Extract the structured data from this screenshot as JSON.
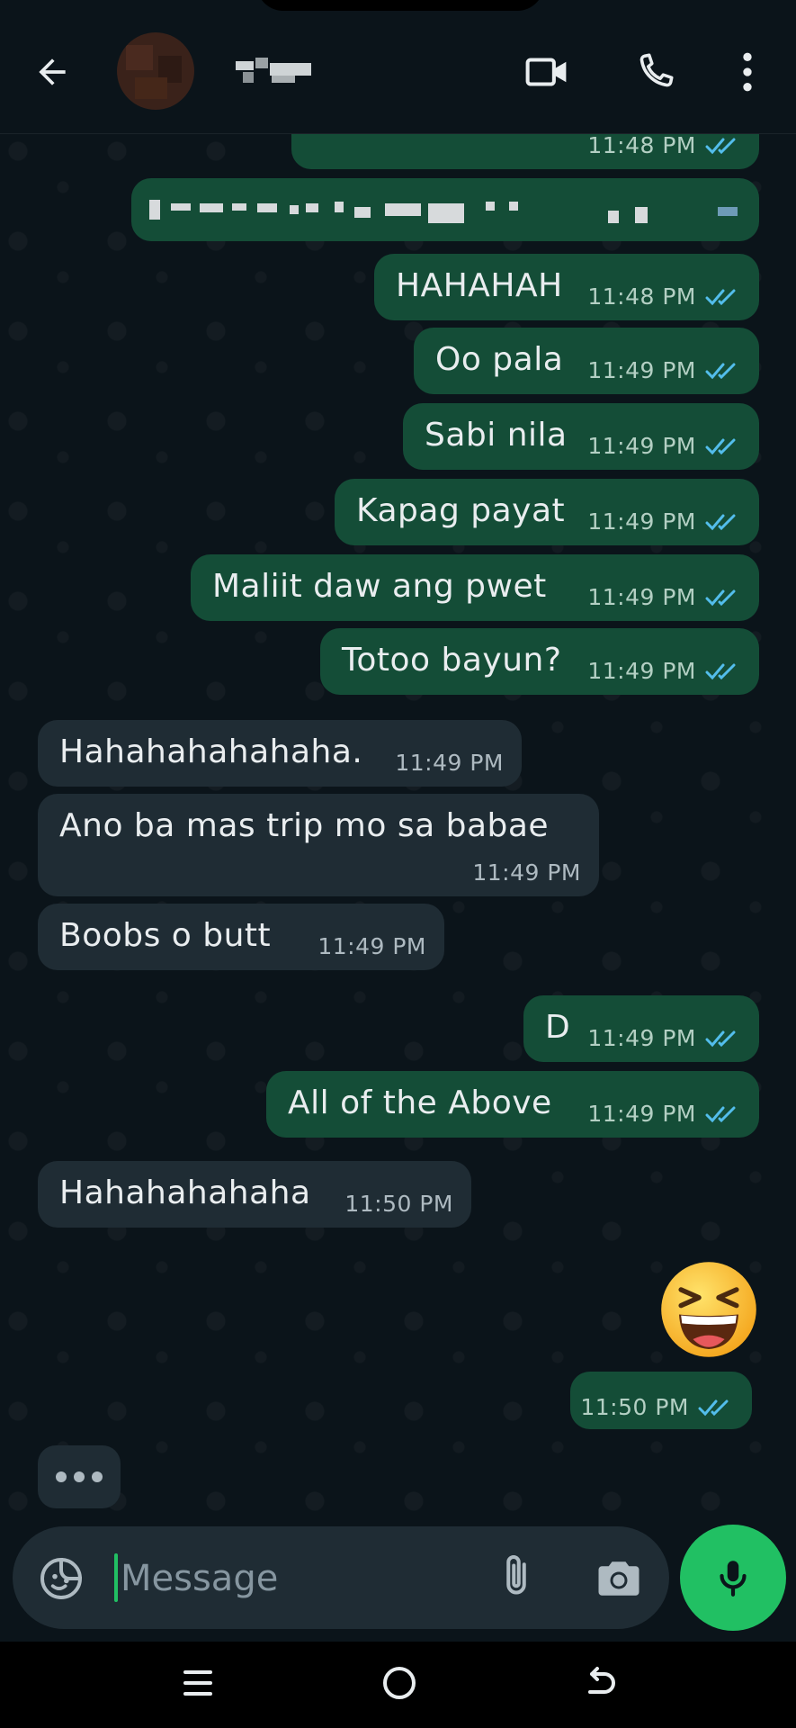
{
  "header": {
    "back_icon": "arrow-left-icon",
    "avatar": "pixelated-contact-photo",
    "contact_name": "(pixelated)",
    "video_icon": "video-camera-icon",
    "call_icon": "phone-icon",
    "more_icon": "more-vert-icon"
  },
  "messages": [
    {
      "dir": "out",
      "text": "",
      "time": "11:48 PM",
      "status": "read"
    },
    {
      "dir": "out",
      "text": "",
      "time": "",
      "status": ""
    },
    {
      "dir": "out",
      "text": "HAHAHAH",
      "time": "11:48 PM",
      "status": "read"
    },
    {
      "dir": "out",
      "text": "Oo pala",
      "time": "11:49 PM",
      "status": "read"
    },
    {
      "dir": "out",
      "text": "Sabi nila",
      "time": "11:49 PM",
      "status": "read"
    },
    {
      "dir": "out",
      "text": "Kapag payat",
      "time": "11:49 PM",
      "status": "read"
    },
    {
      "dir": "out",
      "text": "Maliit daw ang pwet",
      "time": "11:49 PM",
      "status": "read"
    },
    {
      "dir": "out",
      "text": "Totoo bayun?",
      "time": "11:49 PM",
      "status": "read"
    },
    {
      "dir": "in",
      "text": "Hahahahahahaha.",
      "time": "11:49 PM"
    },
    {
      "dir": "in",
      "text": "Ano ba mas trip mo sa babae",
      "time": "11:49 PM"
    },
    {
      "dir": "in",
      "text": "Boobs o butt",
      "time": "11:49 PM"
    },
    {
      "dir": "out",
      "text": "D",
      "time": "11:49 PM",
      "status": "read"
    },
    {
      "dir": "out",
      "text": "All of the Above",
      "time": "11:49 PM",
      "status": "read"
    },
    {
      "dir": "in",
      "text": "Hahahahahaha",
      "time": "11:50 PM"
    },
    {
      "dir": "out",
      "text": "😆",
      "time": "11:50 PM",
      "status": "read",
      "type": "emoji"
    }
  ],
  "typing_indicator": "typing-dots",
  "composer": {
    "placeholder": "Message",
    "emoji_icon": "sticker-icon",
    "attach_icon": "paperclip-icon",
    "camera_icon": "camera-icon",
    "mic_icon": "microphone-icon"
  },
  "colors": {
    "background": "#0b141a",
    "outgoing_bubble": "#144d37",
    "incoming_bubble": "#1f2c34",
    "read_ticks": "#53bdeb",
    "accent": "#21c063"
  }
}
